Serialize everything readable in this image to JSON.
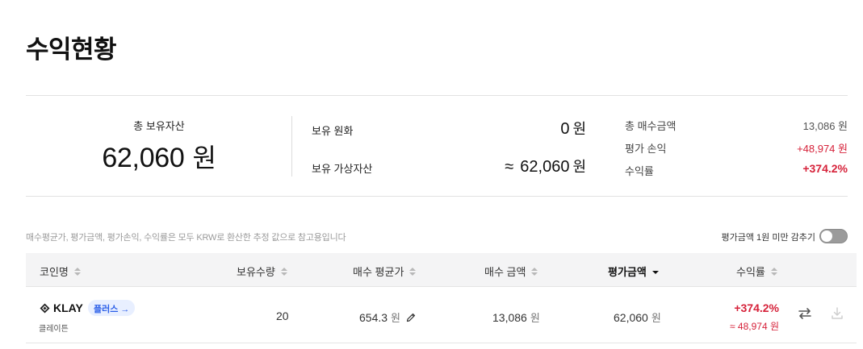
{
  "page_title": "수익현황",
  "summary": {
    "total_assets_label": "총 보유자산",
    "total_assets_value": "62,060",
    "total_assets_unit": "원",
    "krw_label": "보유 원화",
    "krw_value": "0",
    "krw_unit": "원",
    "crypto_label": "보유 가상자산",
    "crypto_approx": "≈",
    "crypto_value": "62,060",
    "crypto_unit": "원",
    "total_buy_label": "총 매수금액",
    "total_buy_value": "13,086 원",
    "eval_pl_label": "평가 손익",
    "eval_pl_value": "+48,974 원",
    "return_label": "수익률",
    "return_value": "+374.2%"
  },
  "notice": "매수평균가, 평가금액, 평가손익, 수익률은 모두 KRW로 환산한 추정 값으로 참고용입니다",
  "hide_small_label": "평가금액 1원 미만 감추기",
  "hide_small_enabled": false,
  "table": {
    "headers": {
      "coin": "코인명",
      "qty": "보유수량",
      "avg_price": "매수 평균가",
      "buy_amount": "매수 금액",
      "eval_amount": "평가금액",
      "return": "수익률"
    },
    "sorted_column": "eval_amount",
    "sort_direction": "desc",
    "rows": [
      {
        "symbol": "KLAY",
        "badge": "플러스 →",
        "name": "클레이튼",
        "qty": "20",
        "avg_price": "654.3",
        "avg_unit": "원",
        "buy_amount": "13,086",
        "buy_unit": "원",
        "eval_amount": "62,060",
        "eval_unit": "원",
        "return_pct": "+374.2%",
        "return_amount": "≈ 48,974 원"
      }
    ]
  },
  "colors": {
    "profit_red": "#d6223a",
    "badge_blue": "#2a5ee8",
    "badge_bg": "#e8efff",
    "header_bg": "#f4f4f5"
  }
}
